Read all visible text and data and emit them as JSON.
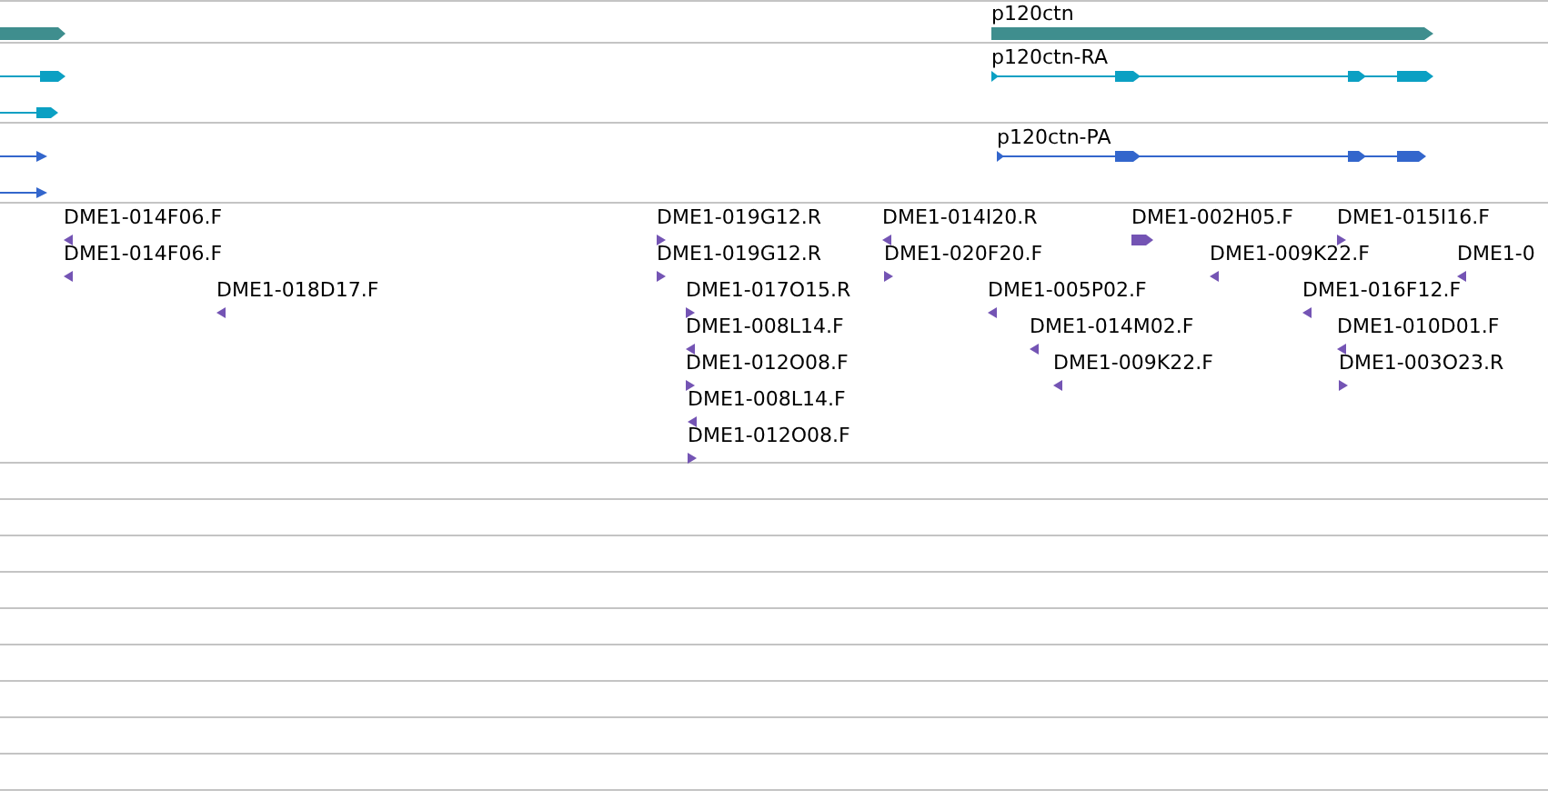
{
  "gene_track": {
    "genes": [
      {
        "label": "p120ctn",
        "color": "#3f8e8e"
      }
    ]
  },
  "transcript_tracks": [
    {
      "color": "#0ba0c3",
      "transcripts": [
        {
          "label": "p120ctn-RA"
        }
      ]
    },
    {
      "color": "#3366cc",
      "transcripts": [
        {
          "label": "p120ctn-PA"
        }
      ]
    }
  ],
  "clone_track": {
    "rows": [
      [
        {
          "label": "DME1-014F06.F",
          "kind": "reverse"
        },
        {
          "label": "DME1-019G12.R",
          "kind": "forward"
        },
        {
          "label": "DME1-014I20.R",
          "kind": "reverse"
        },
        {
          "label": "DME1-002H05.F",
          "kind": "forward"
        },
        {
          "label": "DME1-015I16.F",
          "kind": "forward"
        }
      ],
      [
        {
          "label": "DME1-014F06.F",
          "kind": "reverse"
        },
        {
          "label": "DME1-019G12.R",
          "kind": "forward"
        },
        {
          "label": "DME1-020F20.F",
          "kind": "forward"
        },
        {
          "label": "DME1-009K22.F",
          "kind": "reverse"
        },
        {
          "label": "DME1-0",
          "kind": "reverse"
        }
      ],
      [
        {
          "label": "DME1-018D17.F",
          "kind": "reverse"
        },
        {
          "label": "DME1-017O15.R",
          "kind": "forward"
        },
        {
          "label": "DME1-005P02.F",
          "kind": "reverse"
        },
        {
          "label": "DME1-016F12.F",
          "kind": "reverse"
        }
      ],
      [
        {
          "label": "DME1-008L14.F",
          "kind": "reverse"
        },
        {
          "label": "DME1-014M02.F",
          "kind": "reverse"
        },
        {
          "label": "DME1-010D01.F",
          "kind": "reverse"
        }
      ],
      [
        {
          "label": "DME1-012O08.F",
          "kind": "forward"
        },
        {
          "label": "DME1-009K22.F",
          "kind": "reverse"
        },
        {
          "label": "DME1-003O23.R",
          "kind": "forward"
        }
      ],
      [
        {
          "label": "DME1-008L14.F",
          "kind": "reverse"
        }
      ],
      [
        {
          "label": "DME1-012O08.F",
          "kind": "forward"
        }
      ]
    ]
  }
}
